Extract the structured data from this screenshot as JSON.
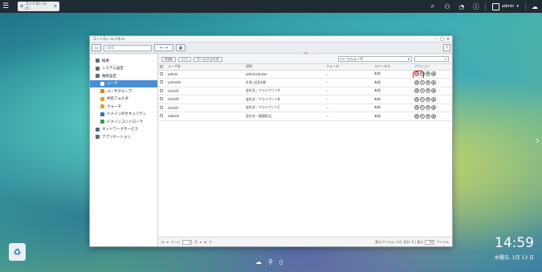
{
  "taskbar": {
    "tab_label": "コントロールパ...",
    "user": "admin",
    "icons": [
      "menu-icon",
      "search-icon",
      "hierarchy-icon",
      "speedometer-icon",
      "info-icon",
      "user-icon",
      "cloud-icon"
    ]
  },
  "window": {
    "title": "コントロールパネル",
    "search_placeholder": "検索",
    "controls": [
      "–",
      "□",
      "×"
    ],
    "help_label": "?"
  },
  "sidebar": {
    "items": [
      {
        "label": "概要",
        "level": 0,
        "color": "#5b6b7a"
      },
      {
        "label": "システム設定",
        "level": 0,
        "color": "#5b6b7a"
      },
      {
        "label": "権限設定",
        "level": 0,
        "color": "#5b6b7a"
      },
      {
        "label": "ユーザ",
        "level": 1,
        "color": "#ffffff",
        "active": true
      },
      {
        "label": "ユーザグループ",
        "level": 1,
        "color": "#d08a1e"
      },
      {
        "label": "共有フォルダ",
        "level": 1,
        "color": "#e0a21e"
      },
      {
        "label": "クォータ",
        "level": 1,
        "color": "#e0a21e"
      },
      {
        "label": "ドメインのセキュリティ",
        "level": 1,
        "color": "#2f6fb8"
      },
      {
        "label": "ドメインコントローラ",
        "level": 1,
        "color": "#3b9a4b"
      },
      {
        "label": "ネットワークサービス",
        "level": 0,
        "color": "#5b6b7a"
      },
      {
        "label": "アプリケーション",
        "level": 0,
        "color": "#5b6b7a"
      }
    ]
  },
  "main": {
    "toolbar": {
      "create": "作成",
      "delete": "削除",
      "home_folder": "ホームフォルダ",
      "domain_select": "ローカルユーザ"
    },
    "columns": [
      "ユーザ名",
      "説明",
      "クォータ",
      "ステータス",
      "アクション"
    ],
    "rows": [
      {
        "name": "admin",
        "desc": "administrator",
        "quota": "--",
        "status": "有効"
      },
      {
        "name": "yamada",
        "desc": "社長 山田太郎",
        "quota": "--",
        "status": "有効"
      },
      {
        "name": "clientA",
        "desc": "会社名・クライアントA",
        "quota": "--",
        "status": "有効"
      },
      {
        "name": "clientB",
        "desc": "会社名・クライアントB",
        "quota": "--",
        "status": "有効"
      },
      {
        "name": "clientC",
        "desc": "会社名・クライアントC",
        "quota": "--",
        "status": "有効"
      },
      {
        "name": "satoshi",
        "desc": "会社名・経理担当",
        "quota": "--",
        "status": "有効"
      }
    ],
    "pager": {
      "page_label": "ページ",
      "page_value": "1",
      "of_label": "/1",
      "range_text": "表示アイテム: 1-6, 合計: 6 | 表示",
      "per_page": "10",
      "item_label": "アイテム"
    }
  },
  "clock": {
    "time": "14:59",
    "date": "水曜日, 1月 13 日"
  },
  "accent": "#4a8fd6",
  "highlight": "#e01b1b"
}
